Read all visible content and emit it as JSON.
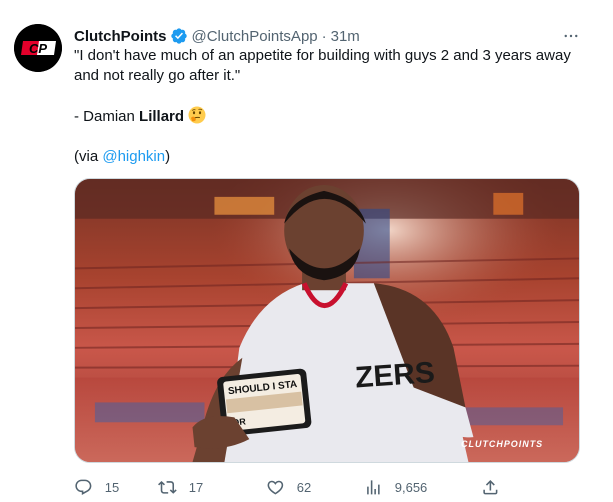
{
  "tweet": {
    "display_name": "ClutchPoints",
    "handle": "@ClutchPointsApp",
    "separator": "·",
    "time": "31m",
    "avatar_text": "CP",
    "text_line1": "\"I don't have much of an appetite for building with guys 2 and 3 years away and not really go after it.\"",
    "attribution_prefix": "- Damian ",
    "attribution_bold": "Lillard",
    "via_prefix": "(via ",
    "via_link": "@highkin",
    "via_suffix": ")"
  },
  "media": {
    "sign_line1": "SHOULD I STA",
    "sign_line2": "OR",
    "jersey_text": "ZERS",
    "watermark": "CLUTCHPOINTS"
  },
  "actions": {
    "reply_count": "15",
    "retweet_count": "17",
    "like_count": "62",
    "views_count": "9,656"
  },
  "icons": {
    "avatar": "clutchpoints-logo",
    "verified": "verified-badge-icon",
    "more": "more-icon",
    "emoji": "thinking-face-emoji",
    "reply": "reply-icon",
    "retweet": "retweet-icon",
    "like": "heart-icon",
    "views": "views-icon",
    "share": "share-icon"
  },
  "colors": {
    "link": "#1d9bf0",
    "secondary_text": "#536471",
    "avatar_red": "#e4002b"
  }
}
